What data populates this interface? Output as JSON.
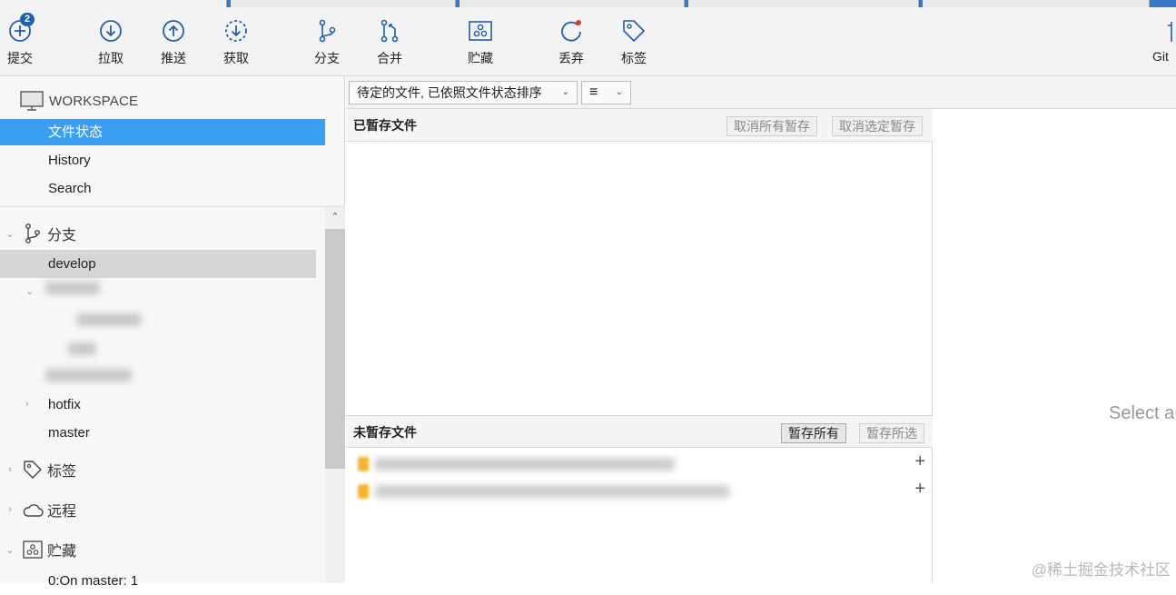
{
  "toolbar": {
    "commit": {
      "label": "提交",
      "badge": "2"
    },
    "pull": {
      "label": "拉取"
    },
    "push": {
      "label": "推送"
    },
    "fetch": {
      "label": "获取"
    },
    "branch": {
      "label": "分支"
    },
    "merge": {
      "label": "合并"
    },
    "stash": {
      "label": "贮藏"
    },
    "discard": {
      "label": "丢弃"
    },
    "tag": {
      "label": "标签"
    },
    "gitflow": {
      "label": "Git"
    }
  },
  "sidebar": {
    "workspace_title": "WORKSPACE",
    "workspace_items": [
      "文件状态",
      "History",
      "Search"
    ],
    "branches_title": "分支",
    "branches": [
      "develop",
      "hotfix",
      "master"
    ],
    "tags_title": "标签",
    "remotes_title": "远程",
    "stashes_title": "贮藏",
    "stash_item": "0:On master: 1"
  },
  "filter": {
    "sort_label": "待定的文件, 已依照文件状态排序",
    "view_icon": "≡"
  },
  "staged": {
    "title": "已暂存文件",
    "unstage_all": "取消所有暂存",
    "unstage_selected": "取消选定暂存"
  },
  "unstaged": {
    "title": "未暂存文件",
    "stage_all": "暂存所有",
    "stage_selected": "暂存所选",
    "files": [
      {
        "add": "+"
      },
      {
        "add": "+"
      }
    ]
  },
  "diff": {
    "placeholder": "Select a"
  },
  "watermark": "@稀土掘金技术社区",
  "colors": {
    "accent": "#3b9ff1",
    "icon": "#1f5fae"
  }
}
